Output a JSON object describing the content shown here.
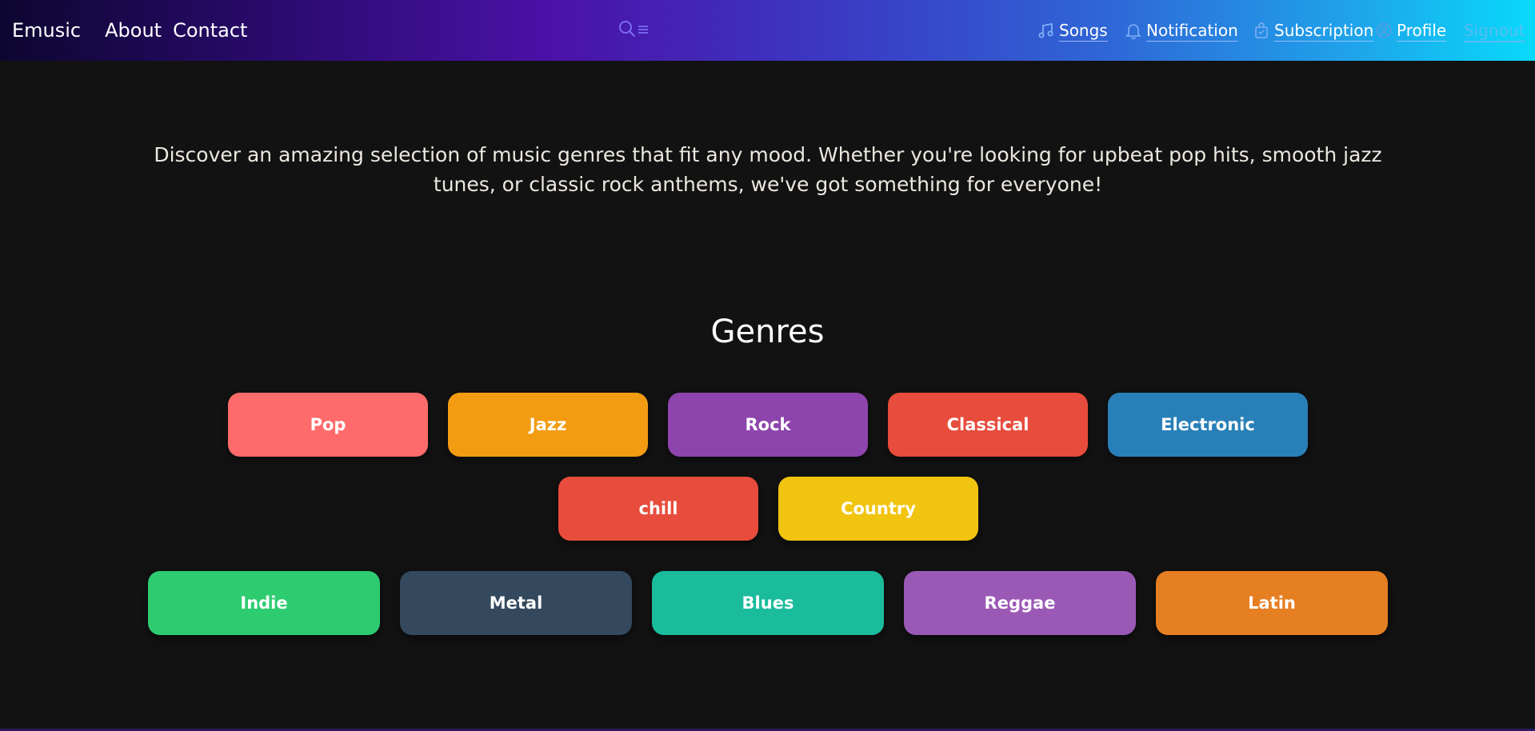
{
  "navbar": {
    "brand": "Emusic",
    "links": [
      {
        "label": "About"
      },
      {
        "label": "Contact"
      }
    ],
    "right": {
      "songs": "Songs",
      "notification": "Notification",
      "subscription": "Subscription",
      "profile": "Profile",
      "signout": "Signout"
    },
    "icons": {
      "search": "search-icon",
      "menu": "menu-icon",
      "songs": "music-note-icon",
      "notification": "bell-icon",
      "subscription": "bag-icon",
      "profile": "user-circle-icon"
    }
  },
  "intro": {
    "text": "Discover an amazing selection of music genres that fit any mood. Whether you're looking for upbeat pop hits, smooth jazz tunes, or classic rock anthems, we've got something for everyone!"
  },
  "genres": {
    "title": "Genres",
    "row1": [
      {
        "label": "Pop",
        "color": "#ff6b6b"
      },
      {
        "label": "Jazz",
        "color": "#f39c12"
      },
      {
        "label": "Rock",
        "color": "#8e44ad"
      },
      {
        "label": "Classical",
        "color": "#e74c3c"
      },
      {
        "label": "Electronic",
        "color": "#2980b9"
      }
    ],
    "row2": [
      {
        "label": "chill",
        "color": "#e74c3c"
      },
      {
        "label": "Country",
        "color": "#f1c40f"
      }
    ],
    "row3": [
      {
        "label": "Indie",
        "color": "#2ecc71"
      },
      {
        "label": "Metal",
        "color": "#34495e"
      },
      {
        "label": "Blues",
        "color": "#1abc9c"
      },
      {
        "label": "Reggae",
        "color": "#9b59b6"
      },
      {
        "label": "Latin",
        "color": "#e67e22"
      }
    ]
  },
  "colors": {
    "background": "#121212",
    "nav_gradient_start": "#0d0630",
    "nav_gradient_mid": "#4b11a8",
    "nav_gradient_end": "#08d9fb",
    "signout": "#6fb8f0"
  }
}
